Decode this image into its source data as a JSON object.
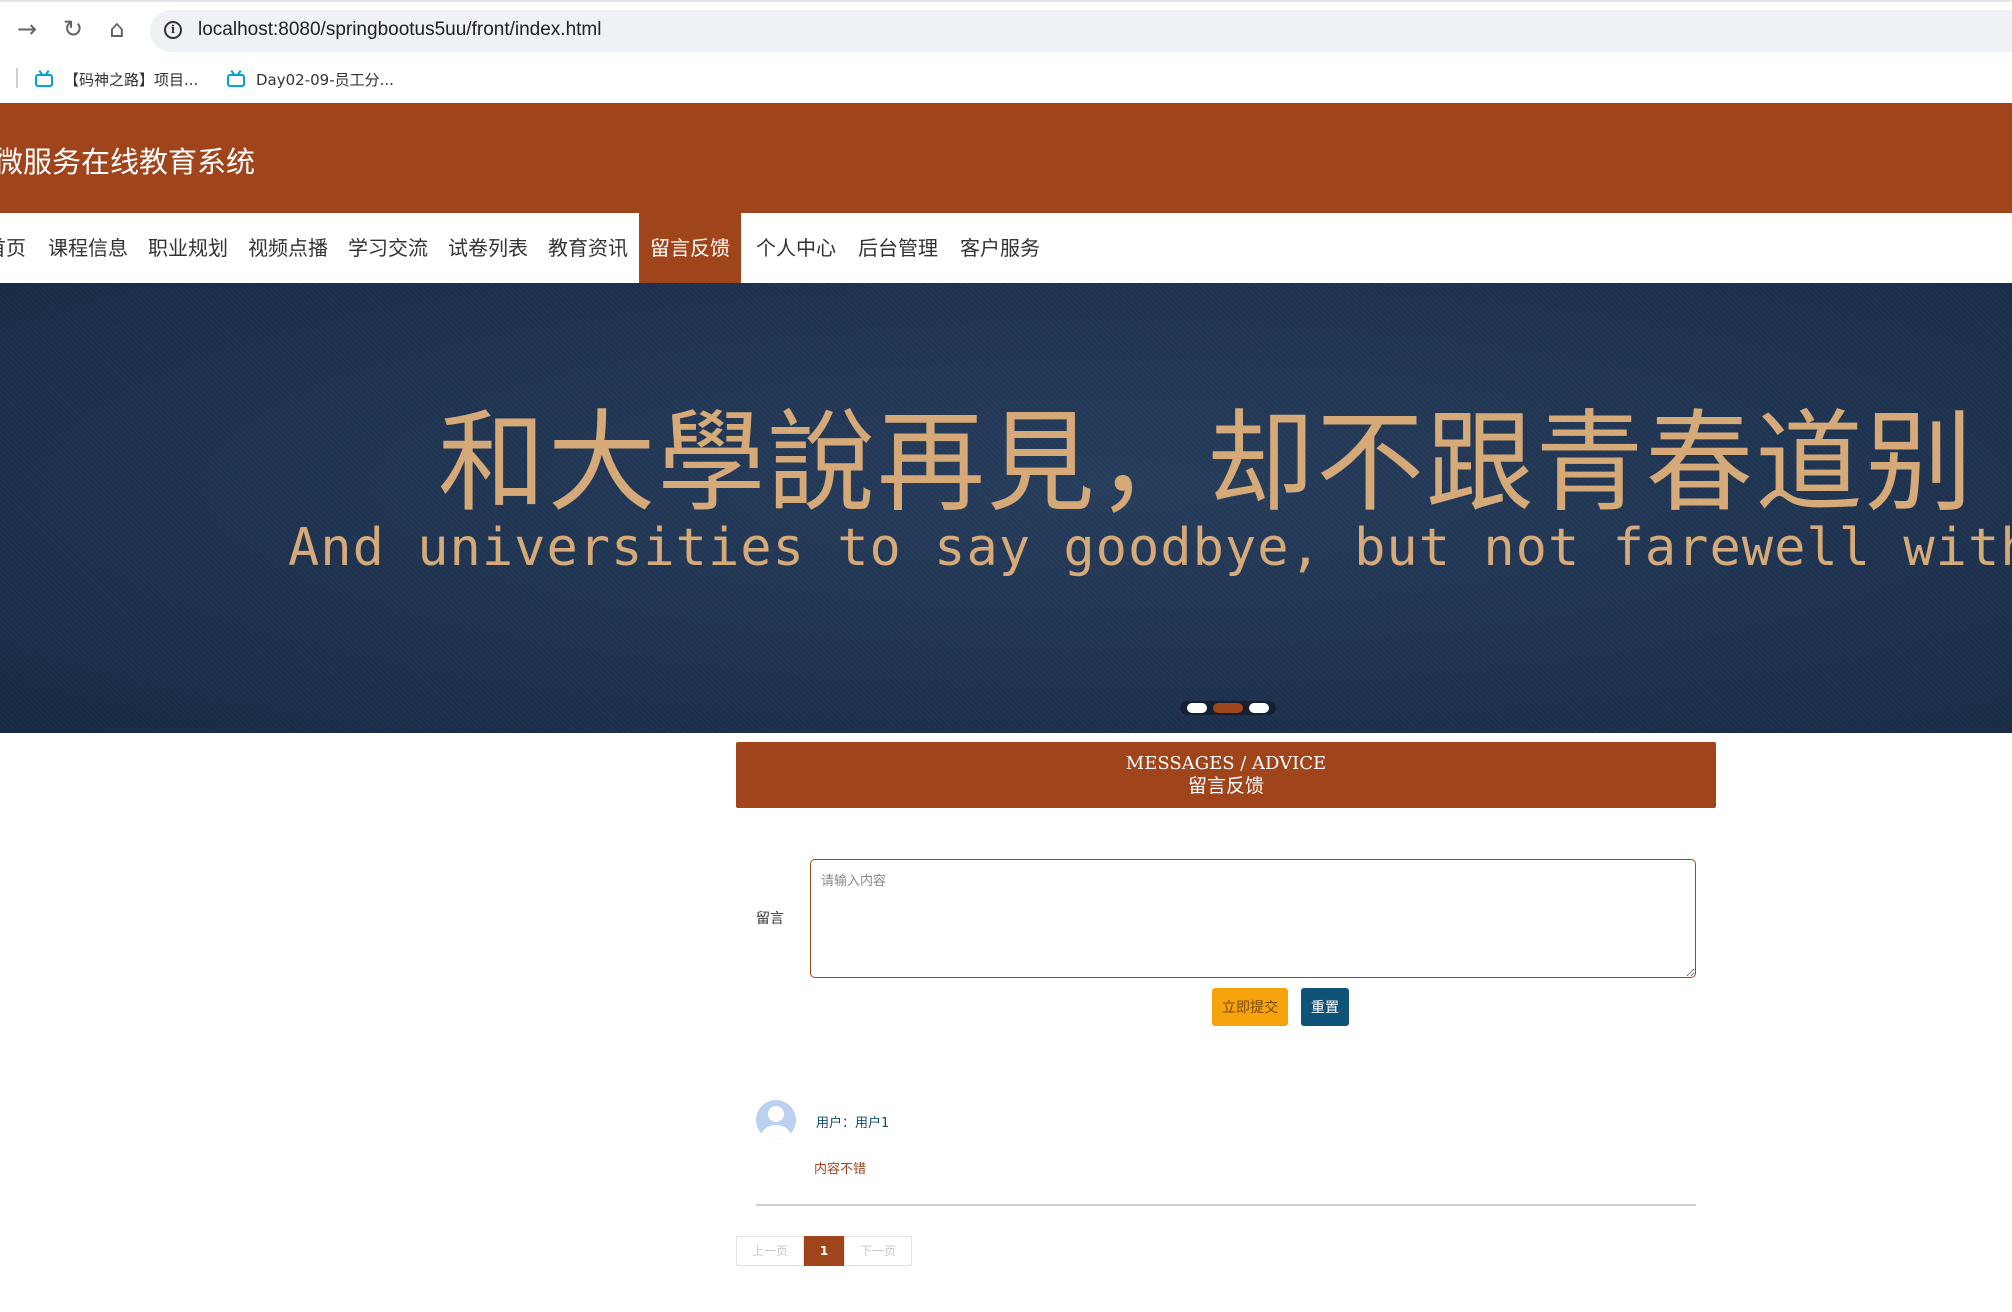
{
  "browser": {
    "url": "localhost:8080/springbootus5uu/front/index.html",
    "bookmarks": [
      {
        "label": "【码神之路】项目..."
      },
      {
        "label": "Day02-09-员工分..."
      }
    ]
  },
  "site": {
    "title": "微服务在线教育系统"
  },
  "nav": {
    "items": [
      {
        "label": "首页"
      },
      {
        "label": "课程信息"
      },
      {
        "label": "职业规划"
      },
      {
        "label": "视频点播"
      },
      {
        "label": "学习交流"
      },
      {
        "label": "试卷列表"
      },
      {
        "label": "教育资讯"
      },
      {
        "label": "留言反馈"
      },
      {
        "label": "个人中心"
      },
      {
        "label": "后台管理"
      },
      {
        "label": "客户服务"
      }
    ],
    "active_index": 7
  },
  "banner": {
    "text_cn": "和大學說再見，却不跟青春道别",
    "text_en": "And universities to say goodbye, but not farewell with you",
    "slide_count": 3,
    "active_slide": 2
  },
  "section": {
    "title_en": "MESSAGES / ADVICE",
    "title_cn": "留言反馈"
  },
  "form": {
    "label": "留言",
    "placeholder": "请输入内容",
    "submit_label": "立即提交",
    "reset_label": "重置"
  },
  "messages": [
    {
      "user_line": "用户：用户1",
      "content": "内容不错"
    }
  ],
  "pager": {
    "prev_label": "上一页",
    "current": "1",
    "next_label": "下一页"
  },
  "colors": {
    "brand": "#a0441b",
    "submit": "#f7a30d",
    "reset": "#0f5478",
    "banner_text": "#d5aa78"
  }
}
